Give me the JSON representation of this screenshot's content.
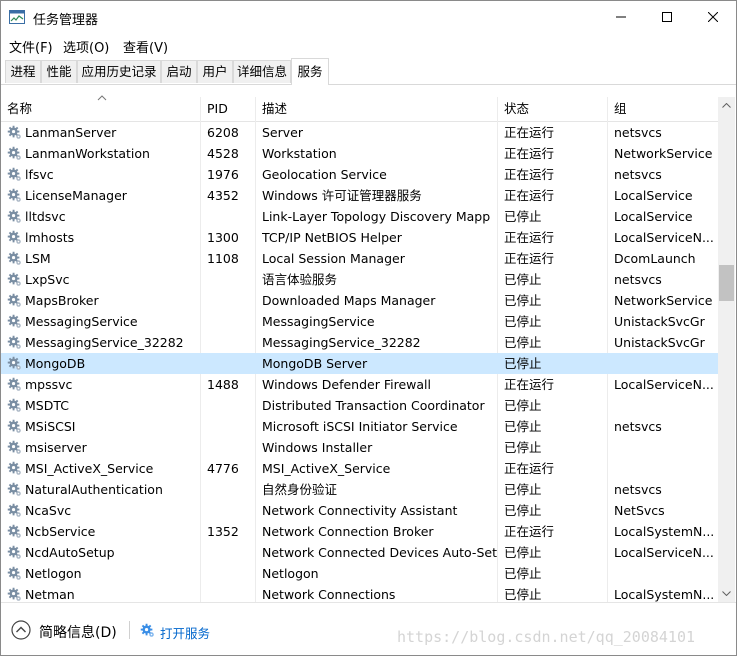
{
  "window": {
    "title": "任务管理器",
    "controls": {
      "minimize": "minimize",
      "maximize": "maximize",
      "close": "close"
    }
  },
  "menu": [
    "文件(F)",
    "选项(O)",
    "查看(V)"
  ],
  "tabs": [
    "进程",
    "性能",
    "应用历史记录",
    "启动",
    "用户",
    "详细信息",
    "服务"
  ],
  "active_tab": "服务",
  "columns": [
    "名称",
    "PID",
    "描述",
    "状态",
    "组"
  ],
  "rows": [
    {
      "name": "LanmanServer",
      "pid": "6208",
      "desc": "Server",
      "status": "正在运行",
      "group": "netsvcs"
    },
    {
      "name": "LanmanWorkstation",
      "pid": "4528",
      "desc": "Workstation",
      "status": "正在运行",
      "group": "NetworkService"
    },
    {
      "name": "lfsvc",
      "pid": "1976",
      "desc": "Geolocation Service",
      "status": "正在运行",
      "group": "netsvcs"
    },
    {
      "name": "LicenseManager",
      "pid": "4352",
      "desc": "Windows 许可证管理器服务",
      "status": "正在运行",
      "group": "LocalService"
    },
    {
      "name": "lltdsvc",
      "pid": "",
      "desc": "Link-Layer Topology Discovery Mapp",
      "status": "已停止",
      "group": "LocalService"
    },
    {
      "name": "lmhosts",
      "pid": "1300",
      "desc": "TCP/IP NetBIOS Helper",
      "status": "正在运行",
      "group": "LocalServiceN..."
    },
    {
      "name": "LSM",
      "pid": "1108",
      "desc": "Local Session Manager",
      "status": "正在运行",
      "group": "DcomLaunch"
    },
    {
      "name": "LxpSvc",
      "pid": "",
      "desc": "语言体验服务",
      "status": "已停止",
      "group": "netsvcs"
    },
    {
      "name": "MapsBroker",
      "pid": "",
      "desc": "Downloaded Maps Manager",
      "status": "已停止",
      "group": "NetworkService"
    },
    {
      "name": "MessagingService",
      "pid": "",
      "desc": "MessagingService",
      "status": "已停止",
      "group": "UnistackSvcGr"
    },
    {
      "name": "MessagingService_32282",
      "pid": "",
      "desc": "MessagingService_32282",
      "status": "已停止",
      "group": "UnistackSvcGr"
    },
    {
      "name": "MongoDB",
      "pid": "",
      "desc": "MongoDB Server",
      "status": "已停止",
      "group": ""
    },
    {
      "name": "mpssvc",
      "pid": "1488",
      "desc": "Windows Defender Firewall",
      "status": "正在运行",
      "group": "LocalServiceN..."
    },
    {
      "name": "MSDTC",
      "pid": "",
      "desc": "Distributed Transaction Coordinator",
      "status": "已停止",
      "group": ""
    },
    {
      "name": "MSiSCSI",
      "pid": "",
      "desc": "Microsoft iSCSI Initiator Service",
      "status": "已停止",
      "group": "netsvcs"
    },
    {
      "name": "msiserver",
      "pid": "",
      "desc": "Windows Installer",
      "status": "已停止",
      "group": ""
    },
    {
      "name": "MSI_ActiveX_Service",
      "pid": "4776",
      "desc": "MSI_ActiveX_Service",
      "status": "正在运行",
      "group": ""
    },
    {
      "name": "NaturalAuthentication",
      "pid": "",
      "desc": "自然身份验证",
      "status": "已停止",
      "group": "netsvcs"
    },
    {
      "name": "NcaSvc",
      "pid": "",
      "desc": "Network Connectivity Assistant",
      "status": "已停止",
      "group": "NetSvcs"
    },
    {
      "name": "NcbService",
      "pid": "1352",
      "desc": "Network Connection Broker",
      "status": "正在运行",
      "group": "LocalSystemN..."
    },
    {
      "name": "NcdAutoSetup",
      "pid": "",
      "desc": "Network Connected Devices Auto-Set",
      "status": "已停止",
      "group": "LocalServiceN..."
    },
    {
      "name": "Netlogon",
      "pid": "",
      "desc": "Netlogon",
      "status": "已停止",
      "group": ""
    },
    {
      "name": "Netman",
      "pid": "",
      "desc": "Network Connections",
      "status": "已停止",
      "group": "LocalSystemN..."
    }
  ],
  "selected_row": "MongoDB",
  "footer": {
    "fewer_details": "简略信息(D)",
    "open_services": "打开服务",
    "watermark": "https://blog.csdn.net/qq_20084101"
  },
  "colors": {
    "selected_row": "#cce8ff",
    "link": "#0066cc",
    "accent": "#3a8ee6"
  }
}
